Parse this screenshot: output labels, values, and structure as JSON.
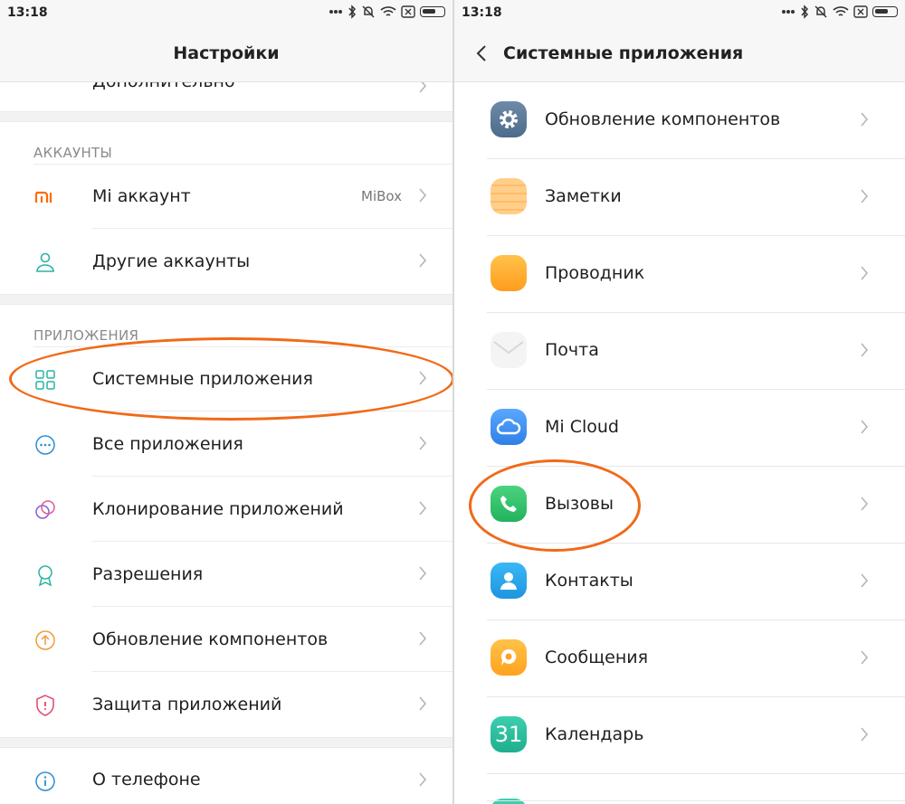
{
  "status_bar": {
    "time": "13:18"
  },
  "left": {
    "title": "Настройки",
    "clipped_item": "Дополнительно",
    "sections": [
      {
        "header": "АККАУНТЫ",
        "items": [
          {
            "label": "Mi аккаунт",
            "value": "MiBox",
            "icon": "mi-logo-icon"
          },
          {
            "label": "Другие аккаунты",
            "icon": "person-icon"
          }
        ]
      },
      {
        "header": "ПРИЛОЖЕНИЯ",
        "items": [
          {
            "label": "Системные приложения",
            "icon": "grid-icon",
            "highlighted": true
          },
          {
            "label": "Все приложения",
            "icon": "more-circle-icon"
          },
          {
            "label": "Клонирование приложений",
            "icon": "clone-circles-icon"
          },
          {
            "label": "Разрешения",
            "icon": "award-icon"
          },
          {
            "label": "Обновление компонентов",
            "icon": "upload-circle-icon"
          },
          {
            "label": "Защита приложений",
            "icon": "shield-icon"
          }
        ]
      }
    ],
    "bottom_item": {
      "label": "О телефоне",
      "icon": "info-icon"
    }
  },
  "right": {
    "title": "Системные приложения",
    "items": [
      {
        "label": "Обновление компонентов",
        "icon": "gear-app-icon"
      },
      {
        "label": "Заметки",
        "icon": "notes-app-icon"
      },
      {
        "label": "Проводник",
        "icon": "explorer-app-icon"
      },
      {
        "label": "Почта",
        "icon": "mail-app-icon"
      },
      {
        "label": "Mi Cloud",
        "icon": "cloud-app-icon"
      },
      {
        "label": "Вызовы",
        "icon": "phone-app-icon",
        "highlighted": true
      },
      {
        "label": "Контакты",
        "icon": "contacts-app-icon"
      },
      {
        "label": "Сообщения",
        "icon": "messages-app-icon"
      },
      {
        "label": "Календарь",
        "icon": "calendar-app-icon",
        "badge": "31"
      }
    ]
  },
  "colors": {
    "highlight_oval": "#f06a18",
    "mi_orange": "#ff6a00",
    "icon_teal": "#2bb3a3"
  }
}
